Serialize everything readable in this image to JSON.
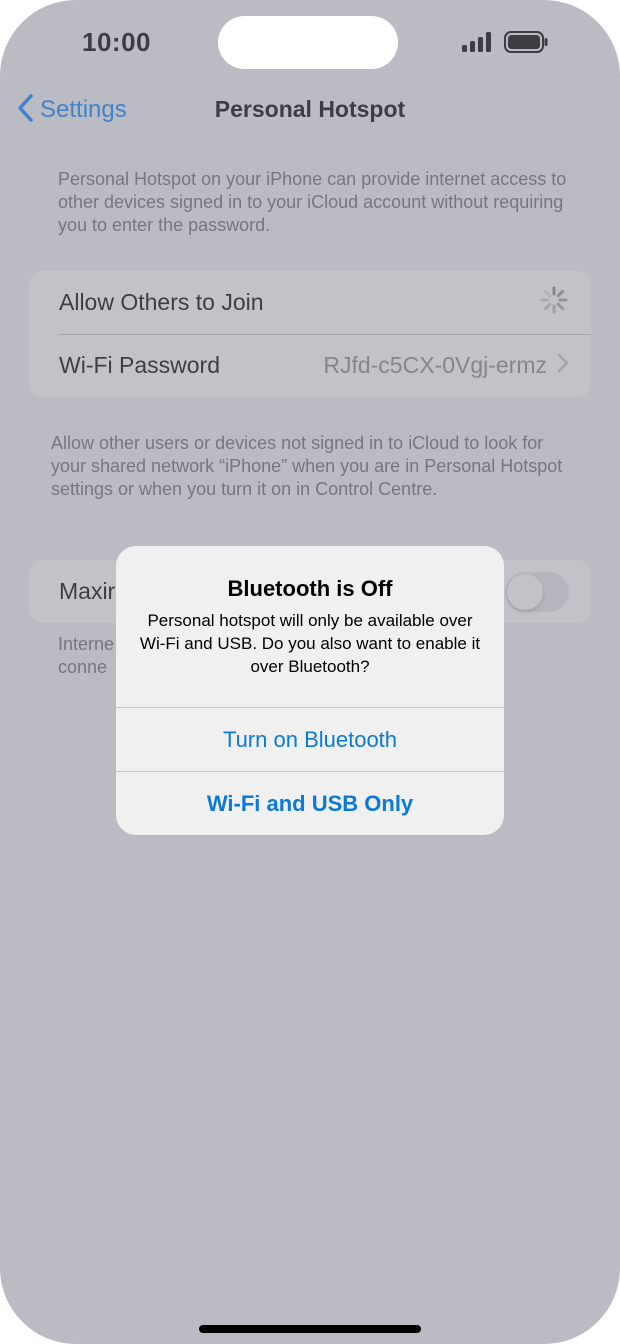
{
  "status_bar": {
    "time": "10:00"
  },
  "nav": {
    "back_label": "Settings",
    "title": "Personal Hotspot"
  },
  "intro_note": "Personal Hotspot on your iPhone can provide internet access to other devices signed in to your iCloud account without requiring you to enter the password.",
  "settings": {
    "allow_others_label": "Allow Others to Join",
    "wifi_password_label": "Wi-Fi Password",
    "wifi_password_value": "RJfd-c5CX-0Vgj-ermz"
  },
  "allow_note": "Allow other users or devices not signed in to iCloud to look for your shared network “iPhone” when you are in Personal Hotspot settings or when you turn it on in Control Centre.",
  "compat": {
    "label_visible": "Maxir",
    "note_visible_line1": "Interne",
    "note_visible_line2": "conne"
  },
  "alert": {
    "title": "Bluetooth is Off",
    "message": "Personal hotspot will only be available over Wi-Fi and USB. Do you also want to enable it over Bluetooth?",
    "button_bluetooth": "Turn on Bluetooth",
    "button_wifi_usb": "Wi-Fi and USB Only"
  },
  "colors": {
    "accent": "#0a84ff",
    "alert_button": "#0a7ad6",
    "dim_overlay": "#80808c"
  },
  "icons": [
    "cellular-signal-icon",
    "battery-icon",
    "chevron-left-icon",
    "spinner-icon",
    "chevron-right-icon"
  ]
}
